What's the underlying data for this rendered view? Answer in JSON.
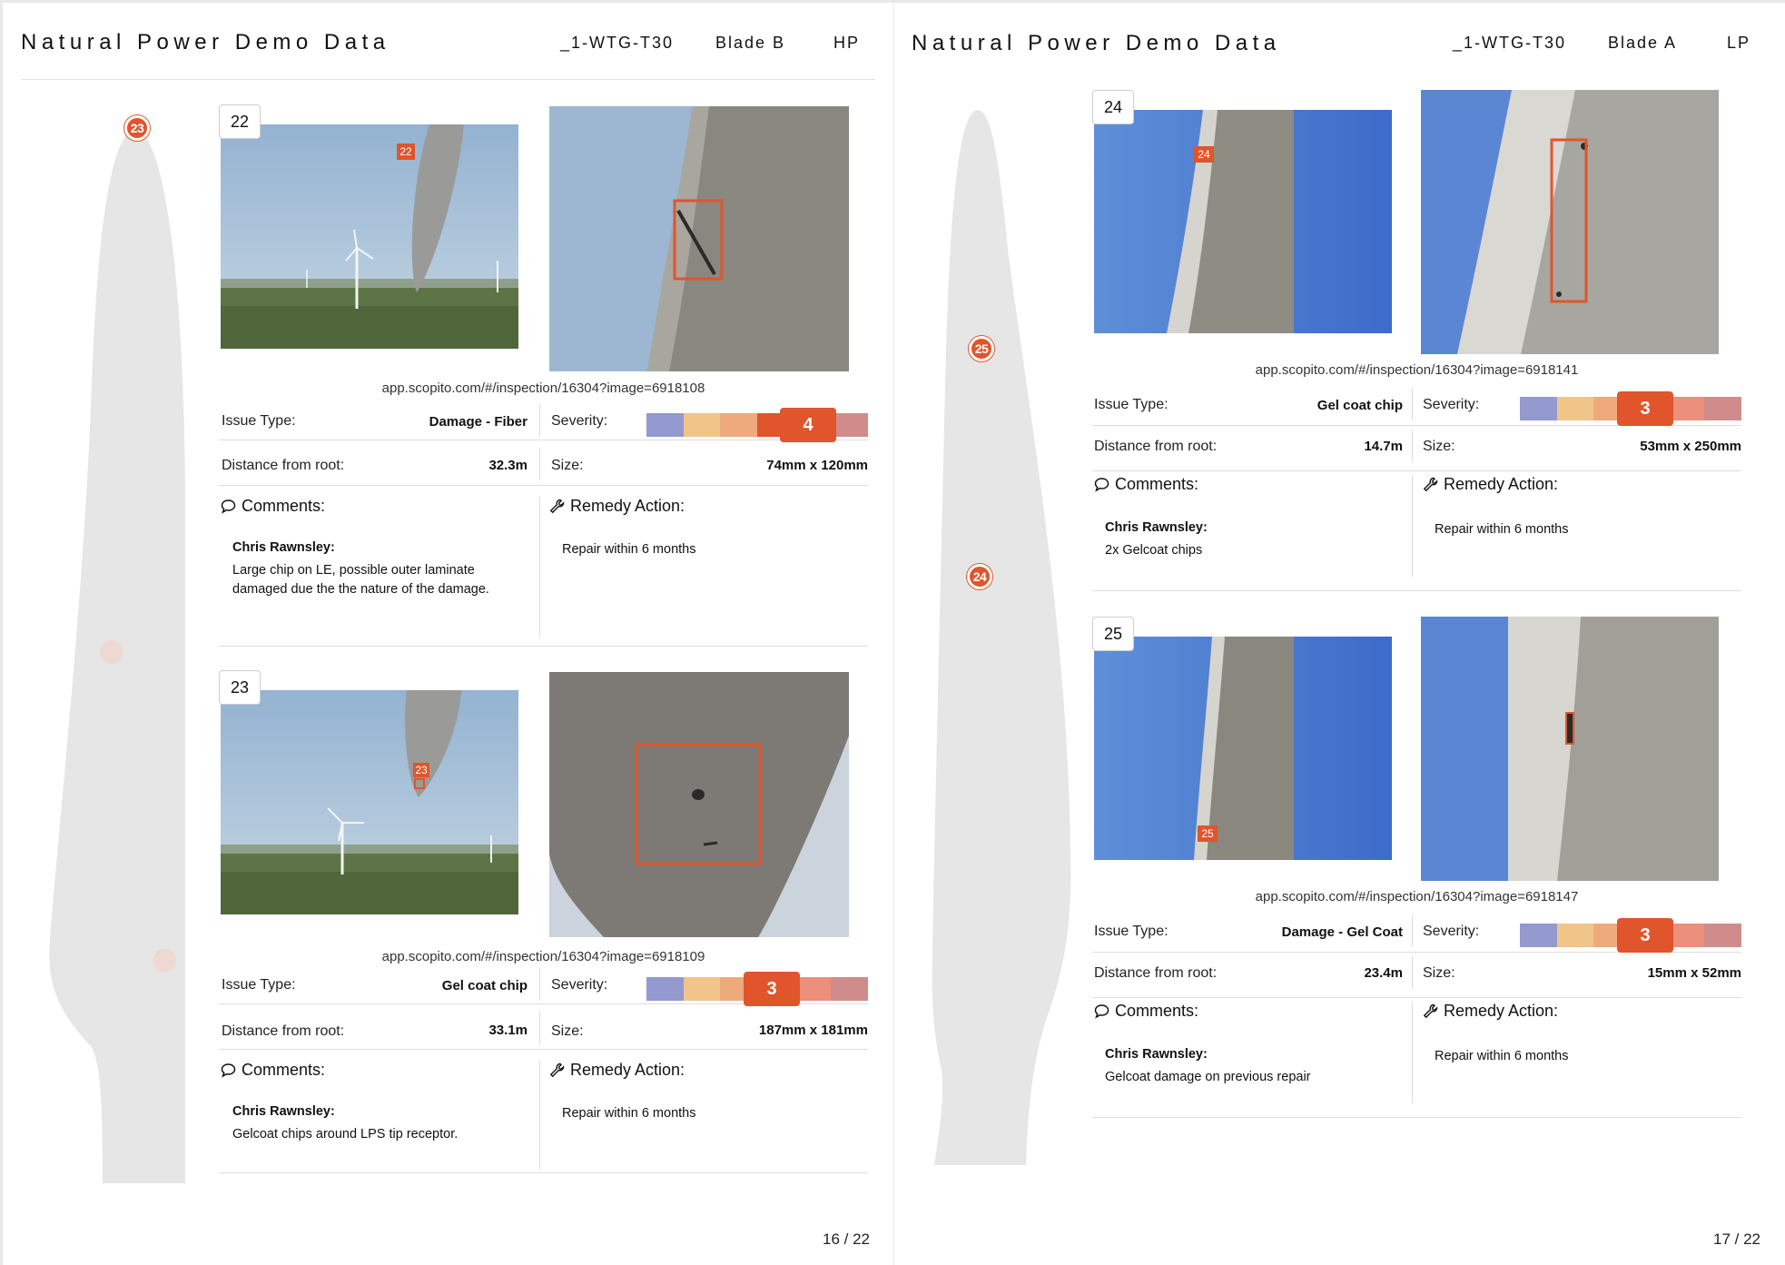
{
  "pages": [
    {
      "header": {
        "title": "Natural Power Demo Data",
        "turbine": "_1-WTG-T30",
        "blade": "Blade B",
        "side": "HP"
      },
      "page_number": "16 / 22",
      "blade_markers": [
        "23"
      ],
      "cards": [
        {
          "number": "22",
          "overview_tag": "22",
          "link": "app.scopito.com/#/inspection/16304?image=6918108",
          "issue_type_label": "Issue Type:",
          "issue_type": "Damage - Fiber",
          "severity_label": "Severity:",
          "severity": "4",
          "distance_label": "Distance from root:",
          "distance": "32.3m",
          "size_label": "Size:",
          "size": "74mm x 120mm",
          "comments_label": "Comments:",
          "author": "Chris Rawnsley:",
          "comment": "Large chip on LE, possible outer laminate damaged due the the nature of the damage.",
          "remedy_label": "Remedy Action:",
          "remedy": "Repair within 6 months"
        },
        {
          "number": "23",
          "overview_tag": "23",
          "link": "app.scopito.com/#/inspection/16304?image=6918109",
          "issue_type_label": "Issue Type:",
          "issue_type": "Gel coat chip",
          "severity_label": "Severity:",
          "severity": "3",
          "distance_label": "Distance from root:",
          "distance": "33.1m",
          "size_label": "Size:",
          "size": "187mm x 181mm",
          "comments_label": "Comments:",
          "author": "Chris Rawnsley:",
          "comment": "Gelcoat chips around LPS tip receptor.",
          "remedy_label": "Remedy Action:",
          "remedy": "Repair within 6 months"
        }
      ]
    },
    {
      "header": {
        "title": "Natural Power Demo Data",
        "turbine": "_1-WTG-T30",
        "blade": "Blade A",
        "side": "LP"
      },
      "page_number": "17 / 22",
      "blade_markers": [
        "25",
        "24"
      ],
      "cards": [
        {
          "number": "24",
          "overview_tag": "24",
          "link": "app.scopito.com/#/inspection/16304?image=6918141",
          "issue_type_label": "Issue Type:",
          "issue_type": "Gel coat chip",
          "severity_label": "Severity:",
          "severity": "3",
          "distance_label": "Distance from root:",
          "distance": "14.7m",
          "size_label": "Size:",
          "size": "53mm x 250mm",
          "comments_label": "Comments:",
          "author": "Chris Rawnsley:",
          "comment": "2x Gelcoat chips",
          "remedy_label": "Remedy Action:",
          "remedy": "Repair within 6 months"
        },
        {
          "number": "25",
          "overview_tag": "25",
          "link": "app.scopito.com/#/inspection/16304?image=6918147",
          "issue_type_label": "Issue Type:",
          "issue_type": "Damage - Gel Coat",
          "severity_label": "Severity:",
          "severity": "3",
          "distance_label": "Distance from root:",
          "distance": "23.4m",
          "size_label": "Size:",
          "size": "15mm x 52mm",
          "comments_label": "Comments:",
          "author": "Chris Rawnsley:",
          "comment": "Gelcoat damage on previous repair",
          "remedy_label": "Remedy Action:",
          "remedy": "Repair within 6 months"
        }
      ]
    }
  ],
  "severity_scale_colors": [
    "#9499d0",
    "#f1c58a",
    "#eeaa7c",
    "#e0552c",
    "#ec8f7c",
    "#cf8c8a"
  ],
  "icons": {
    "comments": "speech-bubble-icon",
    "remedy": "wrench-icon"
  }
}
